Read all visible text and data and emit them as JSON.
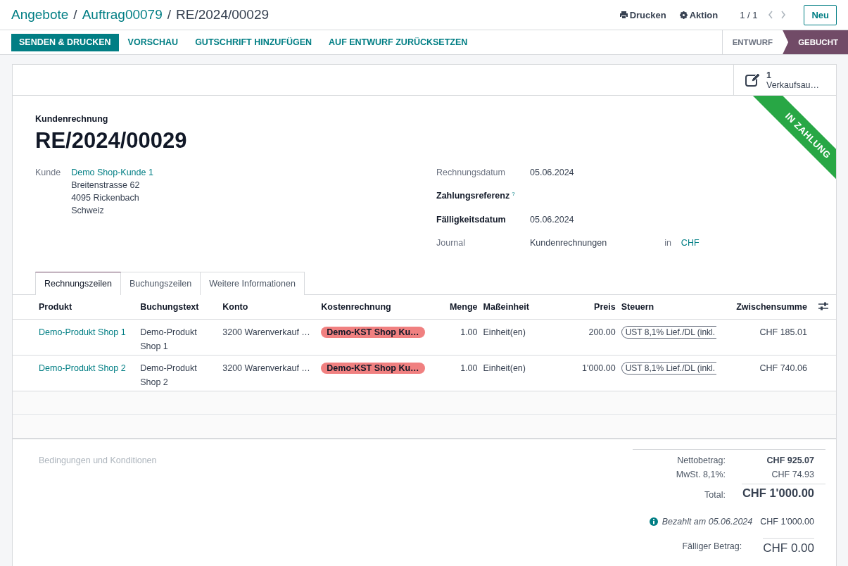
{
  "breadcrumbs": [
    {
      "label": "Angebote",
      "kind": "link"
    },
    {
      "label": "Auftrag00079",
      "kind": "link"
    },
    {
      "label": "RE/2024/00029",
      "kind": "current"
    }
  ],
  "breadcrumb_separator": "/",
  "toolbar": {
    "print": "Drucken",
    "action": "Aktion",
    "pager": "1 / 1",
    "new_button": "Neu"
  },
  "actions": [
    {
      "label": "SENDEN & DRUCKEN",
      "primary": true
    },
    {
      "label": "VORSCHAU",
      "primary": false
    },
    {
      "label": "GUTSCHRIFT HINZUFÜGEN",
      "primary": false
    },
    {
      "label": "AUF ENTWURF ZURÜCKSETZEN",
      "primary": false
    }
  ],
  "status_steps": [
    {
      "label": "ENTWURF",
      "selected": false
    },
    {
      "label": "GEBUCHT",
      "selected": true
    }
  ],
  "smart_button": {
    "count": "1",
    "label": "Verkaufsau…"
  },
  "ribbon": "IN ZAHLUNG",
  "document_type": "Kundenrechnung",
  "number": "RE/2024/00029",
  "customer": {
    "label": "Kunde",
    "name": "Demo Shop-Kunde 1",
    "address": [
      "Breitenstrasse 62",
      "4095 Rickenbach",
      "Schweiz"
    ]
  },
  "fields": [
    {
      "label": "Rechnungsdatum",
      "value": "05.06.2024",
      "required": false
    },
    {
      "label": "Zahlungsreferenz",
      "help": "?",
      "required": true
    },
    {
      "label": "Fälligkeitsdatum",
      "value": "05.06.2024",
      "required": true
    },
    {
      "label": "Journal",
      "value": "Kundenrechnungen",
      "extra_label": "in",
      "extra_value": "CHF",
      "required": false
    }
  ],
  "tabs": [
    {
      "label": "Rechnungszeilen",
      "selected": true
    },
    {
      "label": "Buchungszeilen",
      "selected": false
    },
    {
      "label": "Weitere Informationen",
      "selected": false
    }
  ],
  "table": {
    "columns": [
      "Produkt",
      "Buchungstext",
      "Konto",
      "Kostenrechnung",
      "Menge",
      "Maßeinheit",
      "Preis",
      "Steuern",
      "Zwischensumme"
    ],
    "rows": [
      {
        "product": "Demo-Produkt Shop 1",
        "label": "Demo-Produkt Shop 1",
        "account": "3200 Warenverkauf …",
        "analytic": "Demo-KST Shop Ku…",
        "quantity": "1.00",
        "uom": "Einheit(en)",
        "price": "200.00",
        "tax": "UST 8,1% Lief./DL (inkl.",
        "subtotal": "CHF 185.01"
      },
      {
        "product": "Demo-Produkt Shop 2",
        "label": "Demo-Produkt Shop 2",
        "account": "3200 Warenverkauf …",
        "analytic": "Demo-KST Shop Ku…",
        "quantity": "1.00",
        "uom": "Einheit(en)",
        "price": "1'000.00",
        "tax": "UST 8,1% Lief./DL (inkl.",
        "subtotal": "CHF 740.06"
      }
    ]
  },
  "terms": {
    "placeholder": "Bedingungen und Konditionen"
  },
  "totals": {
    "untaxed_label": "Nettobetrag:",
    "untaxed": "CHF 925.07",
    "tax_label": "MwSt. 8,1%:",
    "tax": "CHF 74.93",
    "total_label": "Total:",
    "total": "CHF 1'000.00",
    "payment_label": "Bezahlt am 05.06.2024",
    "payment": "CHF 1'000.00",
    "due_label": "Fälliger Betrag:",
    "due": "CHF 0.00"
  }
}
